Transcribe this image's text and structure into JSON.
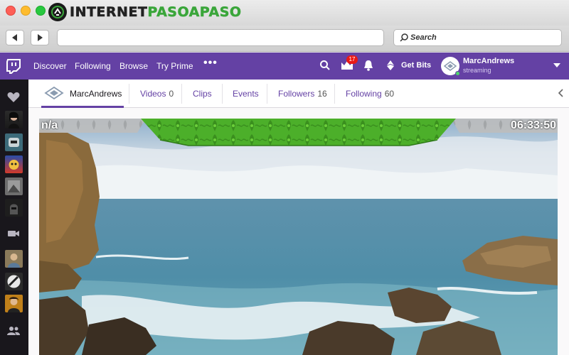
{
  "site": {
    "logo_prefix": "INTERNET",
    "logo_suffix": "PASOAPASO"
  },
  "browser": {
    "search_placeholder": "Search"
  },
  "twitch_nav": {
    "items": [
      {
        "label": "Discover"
      },
      {
        "label": "Following"
      },
      {
        "label": "Browse"
      },
      {
        "label": "Try Prime"
      }
    ],
    "notification_count": "17",
    "get_bits_label": "Get Bits",
    "user": {
      "name": "MarcAndrews",
      "status": "streaming"
    }
  },
  "channel": {
    "name": "MarcAndrews",
    "tabs": [
      {
        "label": "Videos",
        "count": "0"
      },
      {
        "label": "Clips",
        "count": ""
      },
      {
        "label": "Events",
        "count": ""
      },
      {
        "label": "Followers",
        "count": "16"
      },
      {
        "label": "Following",
        "count": "60"
      }
    ]
  },
  "video": {
    "left_overlay": "n/a",
    "timer": "06:33:50"
  },
  "colors": {
    "twitch_purple": "#6441a4",
    "sidebar_dark": "#19171c",
    "overlay_green": "#4caf2a",
    "notification_red": "#e91916"
  }
}
